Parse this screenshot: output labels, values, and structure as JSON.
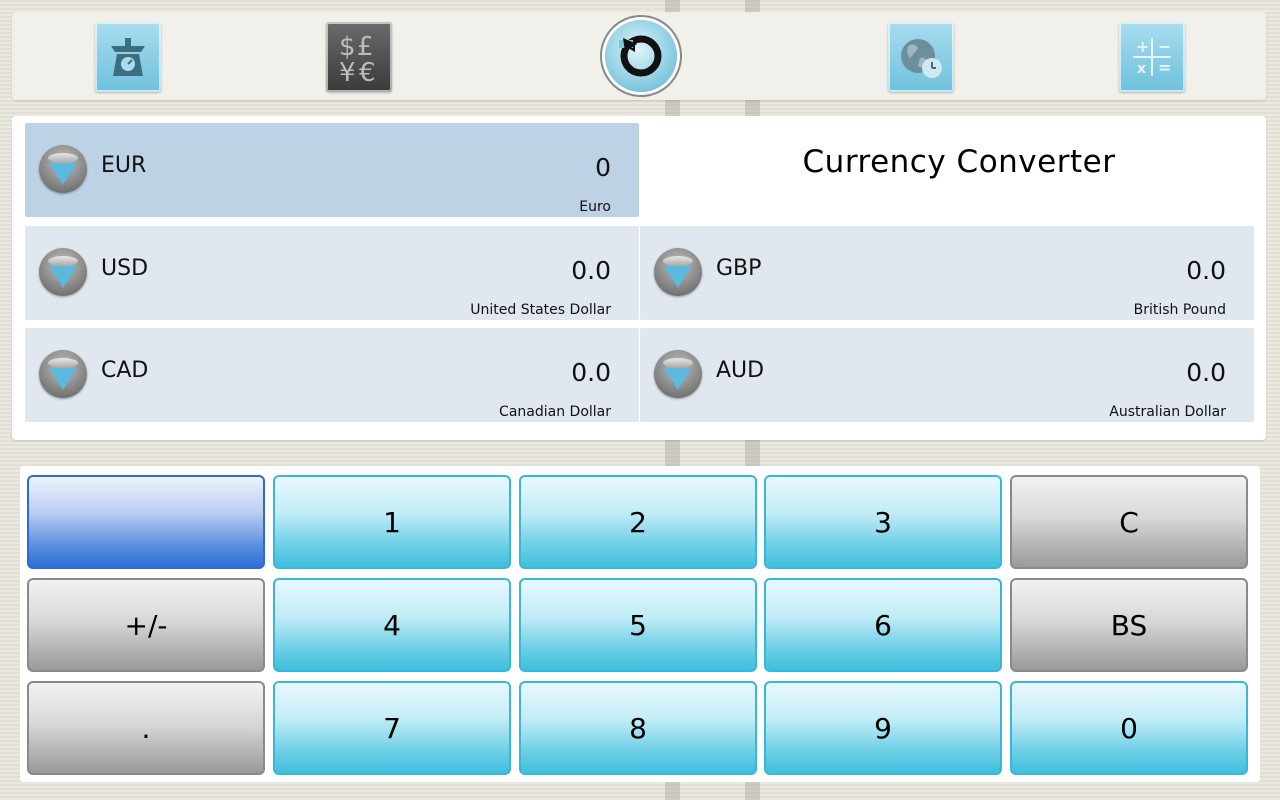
{
  "toolbar": {
    "icons": [
      "scale-icon",
      "currency-symbols-icon",
      "refresh-icon",
      "world-clock-icon",
      "calculator-icon"
    ]
  },
  "title": "Currency Converter",
  "base": {
    "code": "EUR",
    "value": "0",
    "name": "Euro"
  },
  "currencies": [
    {
      "code": "USD",
      "value": "0.0",
      "name": "United States Dollar"
    },
    {
      "code": "GBP",
      "value": "0.0",
      "name": "British Pound"
    },
    {
      "code": "CAD",
      "value": "0.0",
      "name": "Canadian Dollar"
    },
    {
      "code": "AUD",
      "value": "0.0",
      "name": "Australian Dollar"
    }
  ],
  "keypad": {
    "blank": "",
    "k1": "1",
    "k2": "2",
    "k3": "3",
    "clear": "C",
    "sign": "+/-",
    "k4": "4",
    "k5": "5",
    "k6": "6",
    "backspace": "BS",
    "dot": ".",
    "k7": "7",
    "k8": "8",
    "k9": "9",
    "k0": "0"
  },
  "colors": {
    "active_row": "#bed2e5",
    "row": "#e1e7ef",
    "key_cyan": "#3fbfde",
    "key_gray": "#9a9a9a",
    "key_blue": "#2d6fd6"
  }
}
